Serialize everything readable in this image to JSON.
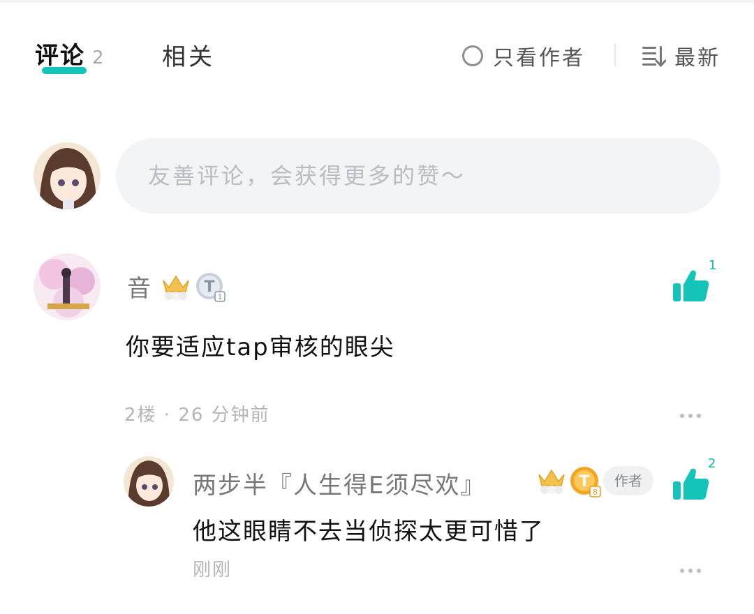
{
  "tabs": {
    "comments_label": "评论",
    "comments_count": "2",
    "related_label": "相关",
    "author_only_label": "只看作者",
    "sort_label": "最新"
  },
  "composer": {
    "placeholder": "友善评论，会获得更多的赞～"
  },
  "comments": [
    {
      "username": "音",
      "badge_letter": "T",
      "badge_level": "1",
      "content": "你要适应tap审核的眼尖",
      "floor_time": "2楼 · 26 分钟前",
      "likes": "1"
    }
  ],
  "reply": {
    "username": "两步半『人生得E须尽欢』",
    "badge_letter": "T",
    "badge_level": "8",
    "author_tag": "作者",
    "content": "他这眼睛不去当侦探太更可惜了",
    "time": "刚刚",
    "likes": "2"
  },
  "colors": {
    "accent": "#14c4b8",
    "like_green": "#14b8ac",
    "input_bg": "#f3f4f6",
    "muted_text": "#b5b5b5"
  },
  "icons": [
    "radio-circle-icon",
    "sort-lines-icon",
    "crown-icon",
    "level-badge-icon",
    "thumbs-up-icon",
    "more-dots-icon"
  ]
}
